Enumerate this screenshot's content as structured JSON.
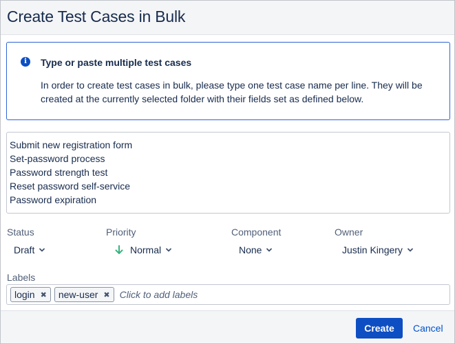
{
  "dialog": {
    "title": "Create Test Cases in Bulk"
  },
  "info": {
    "icon": "info-icon",
    "title": "Type or paste multiple test cases",
    "text": "In order to create test cases in bulk, please type one test case name per line. They will be created at the currently selected folder with their fields set as defined below."
  },
  "test_cases": [
    "Submit new registration form",
    "Set-password process",
    "Password strength test",
    "Reset password self-service",
    "Password expiration"
  ],
  "fields": {
    "status": {
      "label": "Status",
      "value": "Draft"
    },
    "priority": {
      "label": "Priority",
      "value": "Normal",
      "icon": "arrow-down-icon",
      "icon_color": "#36b37e"
    },
    "component": {
      "label": "Component",
      "value": "None"
    },
    "owner": {
      "label": "Owner",
      "value": "Justin Kingery"
    }
  },
  "labels": {
    "label": "Labels",
    "chips": [
      "login",
      "new-user"
    ],
    "placeholder": "Click to add labels"
  },
  "footer": {
    "create": "Create",
    "cancel": "Cancel"
  },
  "colors": {
    "primary": "#0d4ec3",
    "link": "#0052cc",
    "text": "#172b4d",
    "info_border": "#2c63d8"
  }
}
